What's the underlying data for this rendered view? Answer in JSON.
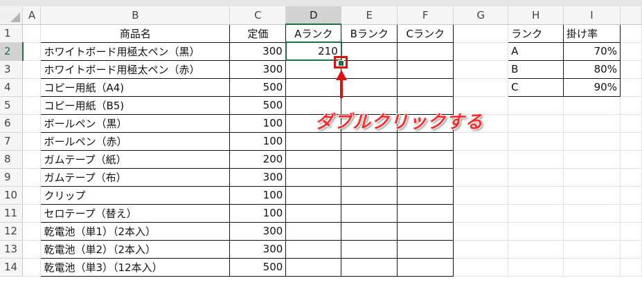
{
  "columns": [
    "A",
    "B",
    "C",
    "D",
    "E",
    "F",
    "G",
    "H",
    "I"
  ],
  "selected": {
    "column": "D",
    "row": "2"
  },
  "header_row": {
    "num": "1",
    "product": "商品名",
    "price": "定価",
    "rank_a": "Aランク",
    "rank_b": "Bランク",
    "rank_c": "Cランク",
    "rank": "ランク",
    "rate": "掛け率"
  },
  "rows": [
    {
      "num": "2",
      "product": "ホワイトボード用極太ペン（黒）",
      "price": "300",
      "rank_a": "210",
      "rank": "A",
      "rate": "70%"
    },
    {
      "num": "3",
      "product": "ホワイトボード用極太ペン（赤）",
      "price": "300",
      "rank": "B",
      "rate": "80%"
    },
    {
      "num": "4",
      "product": "コピー用紙（A4)",
      "price": "500",
      "rank": "C",
      "rate": "90%"
    },
    {
      "num": "5",
      "product": "コピー用紙（B5)",
      "price": "500"
    },
    {
      "num": "6",
      "product": "ボールペン（黒）",
      "price": "100"
    },
    {
      "num": "7",
      "product": "ボールペン（赤）",
      "price": "100"
    },
    {
      "num": "8",
      "product": "ガムテープ（紙）",
      "price": "200"
    },
    {
      "num": "9",
      "product": "ガムテープ（布）",
      "price": "300"
    },
    {
      "num": "10",
      "product": "クリップ",
      "price": "100"
    },
    {
      "num": "11",
      "product": "セロテープ（替え）",
      "price": "100"
    },
    {
      "num": "12",
      "product": "乾電池（単1）（2本入）",
      "price": "300"
    },
    {
      "num": "13",
      "product": "乾電池（単2）（2本入）",
      "price": "300"
    },
    {
      "num": "14",
      "product": "乾電池（単3）（12本入）",
      "price": "500"
    }
  ],
  "annotation": {
    "text": "ダブルクリックする",
    "color": "#ff2a2a"
  },
  "colors": {
    "selection": "#1e7145",
    "highlight": "#dd1010"
  }
}
